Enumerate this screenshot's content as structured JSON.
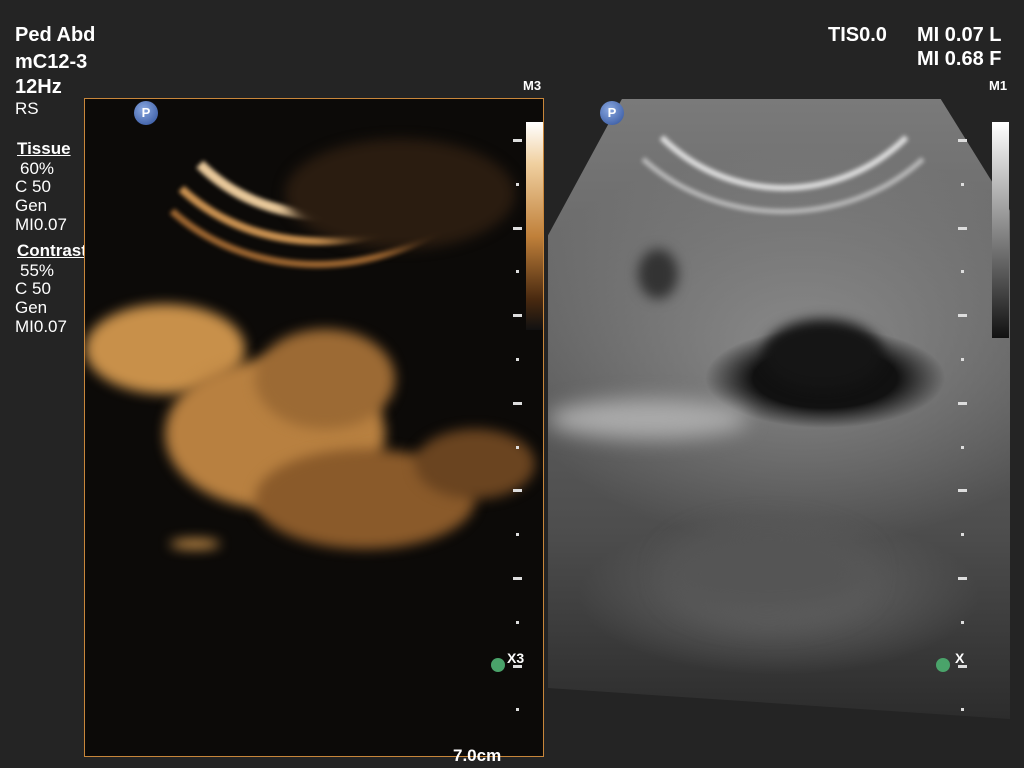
{
  "left_info": {
    "preset": "Ped Abd",
    "probe": "mC12-3",
    "frame_rate": "12Hz",
    "mode": "RS",
    "tissue": {
      "title": "Tissue",
      "gain": "60%",
      "c": "C 50",
      "freq": "Gen",
      "mi": "MI0.07"
    },
    "contrast": {
      "title": "Contrast",
      "gain": "55%",
      "c": "C 50",
      "freq": "Gen",
      "mi": "MI0.07"
    }
  },
  "right_info": {
    "tis": "TIS0.0",
    "mi_line1": "MI 0.07 L",
    "mi_line2": "MI 0.68 F"
  },
  "left_panel": {
    "map_label": "M3",
    "marker": "P",
    "zoom_label": "X3",
    "depth": "7.0cm",
    "colors": {
      "frame": "#c8863a",
      "tint": "#e0a860"
    }
  },
  "right_panel": {
    "map_label": "M1",
    "marker": "P",
    "zoom_label": "X"
  }
}
